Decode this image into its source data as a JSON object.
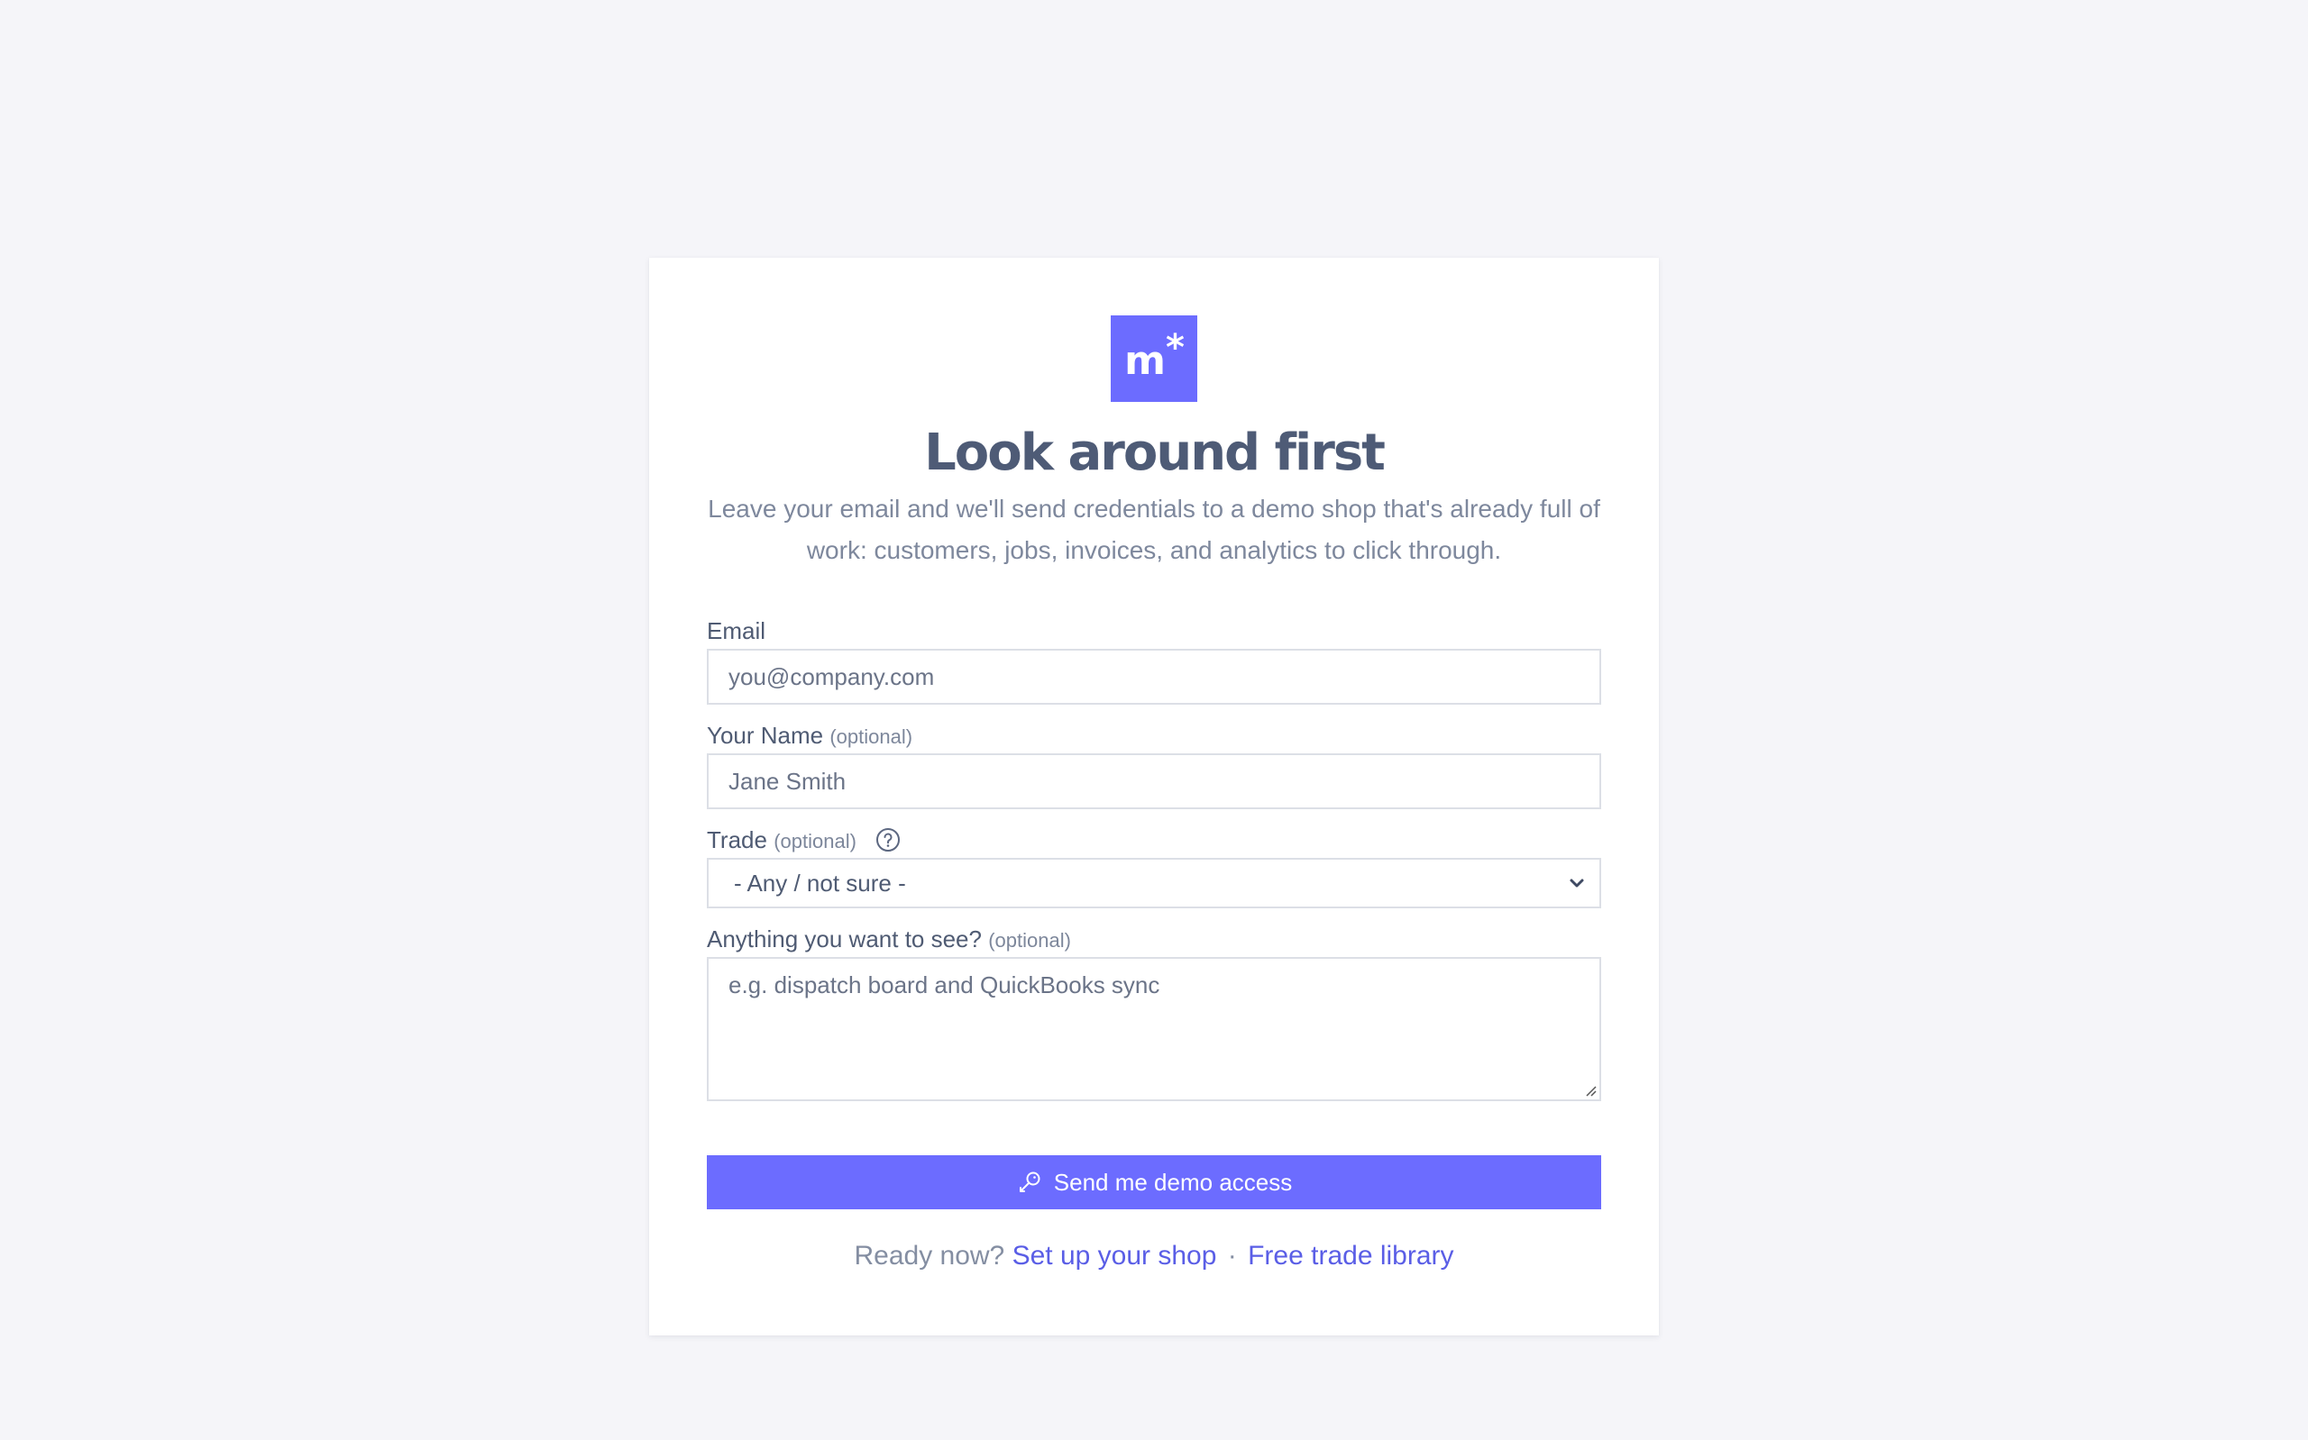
{
  "brand": {
    "logo_text": "m",
    "logo_mark": "*",
    "accent_color": "#6c6cff"
  },
  "header": {
    "title": "Look around first",
    "subtitle": "Leave your email and we'll send credentials to a demo shop that's already full of work: customers, jobs, invoices, and analytics to click through."
  },
  "form": {
    "email": {
      "label": "Email",
      "placeholder": "you@company.com",
      "value": ""
    },
    "name": {
      "label": "Your Name",
      "optional": "(optional)",
      "placeholder": "Jane Smith",
      "value": ""
    },
    "trade": {
      "label": "Trade",
      "optional": "(optional)",
      "help_icon": "question-circle-icon",
      "selected": "- Any / not sure -"
    },
    "wants": {
      "label": "Anything you want to see?",
      "optional": "(optional)",
      "placeholder": "e.g. dispatch board and QuickBooks sync",
      "value": ""
    },
    "submit": {
      "label": "Send me demo access",
      "icon": "key-icon"
    }
  },
  "footer": {
    "prompt": "Ready now?",
    "setup_link": "Set up your shop",
    "separator": "·",
    "library_link": "Free trade library"
  }
}
